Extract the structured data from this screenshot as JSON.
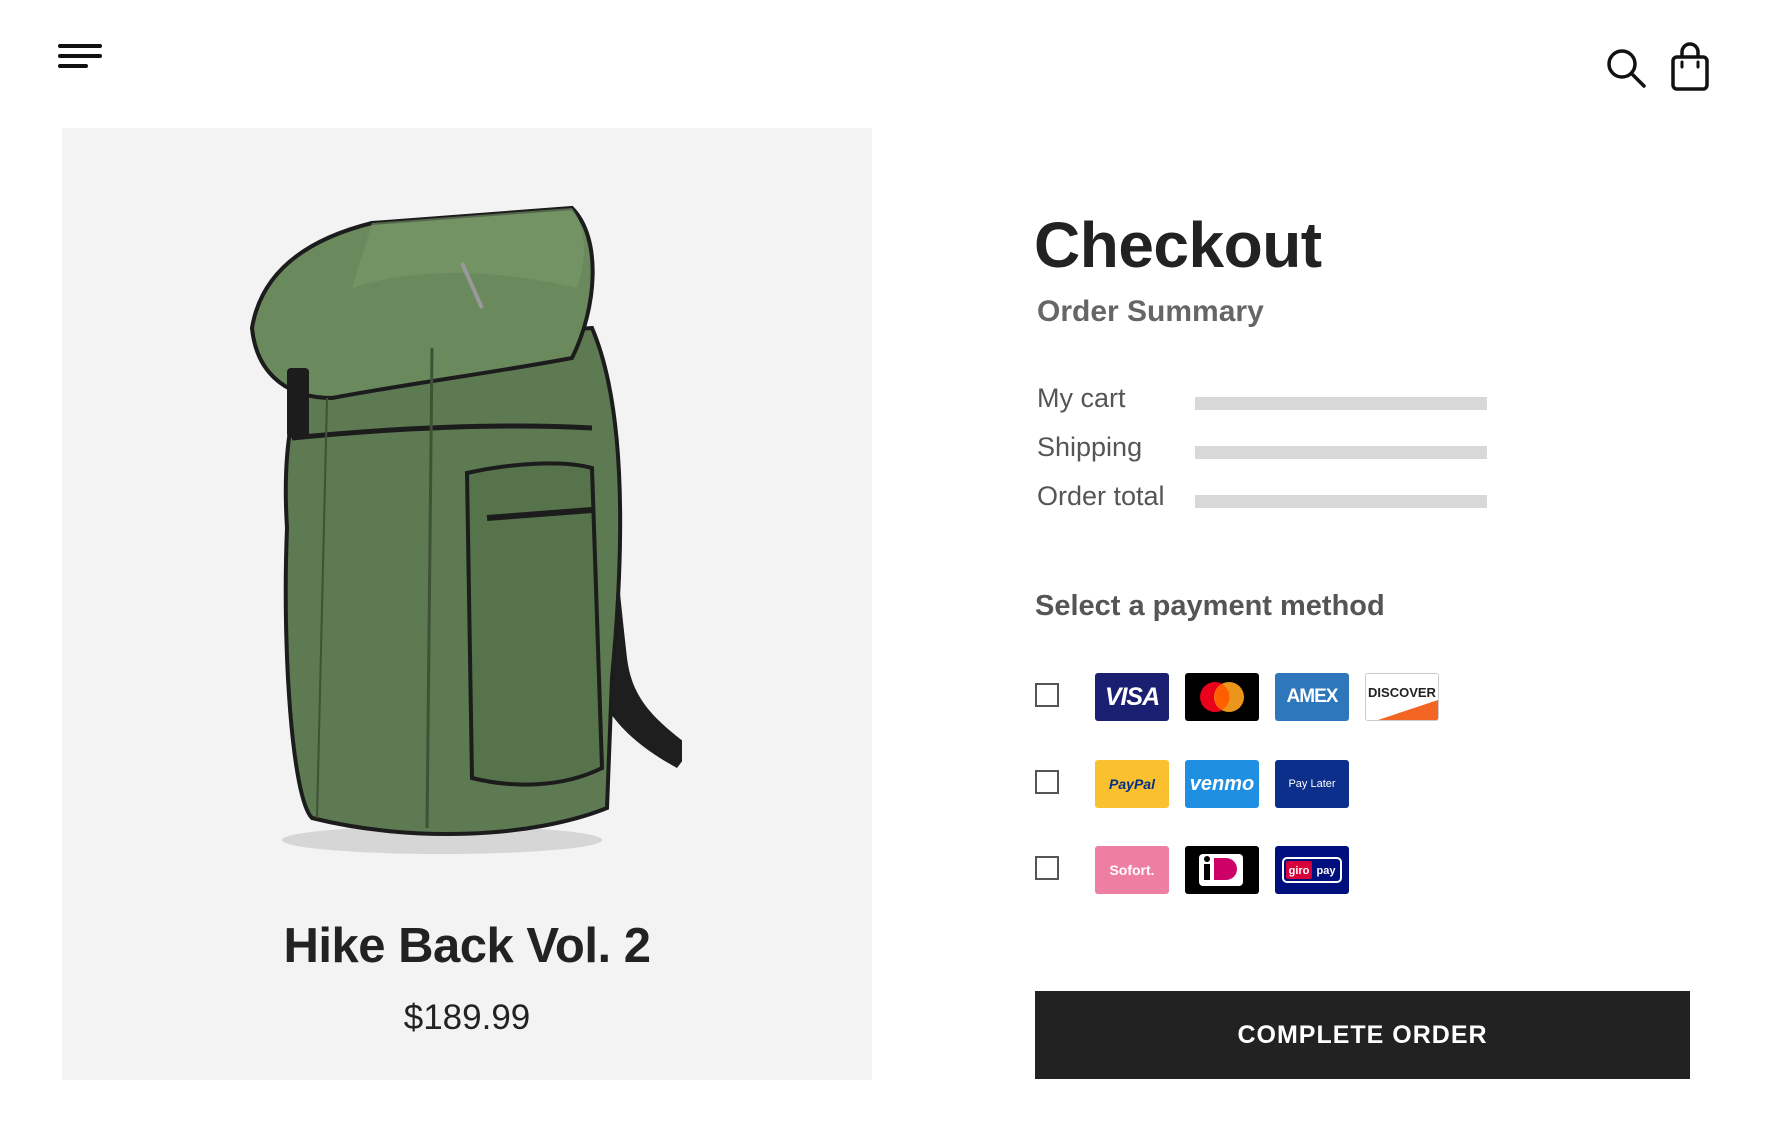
{
  "header": {
    "menu_icon": "hamburger-menu-icon",
    "search_icon": "search-icon",
    "cart_icon": "shopping-bag-icon"
  },
  "product": {
    "name": "Hike Back Vol. 2",
    "price": "$189.99",
    "image": "green-backpack-image",
    "colors": {
      "panel_bg": "#f3f3f3",
      "backpack": "#5d7a52"
    }
  },
  "checkout": {
    "title": "Checkout",
    "summary_title": "Order Summary",
    "summary_rows": [
      {
        "label": "My cart"
      },
      {
        "label": "Shipping"
      },
      {
        "label": "Order total"
      }
    ],
    "payment_title": "Select a payment method",
    "payment_rows": [
      {
        "checked": false,
        "methods": [
          "VISA",
          "Mastercard",
          "AMEX",
          "DISCOVER"
        ]
      },
      {
        "checked": false,
        "methods": [
          "PayPal",
          "venmo",
          "Pay Later"
        ]
      },
      {
        "checked": false,
        "methods": [
          "Sofort.",
          "iDEAL",
          "giropay"
        ]
      }
    ],
    "logo_text": {
      "visa": "VISA",
      "amex": "AMEX",
      "discover": "DISCOVER",
      "paypal": "PayPal",
      "venmo": "venmo",
      "paylater": "Pay Later",
      "sofort": "Sofort.",
      "ideal": "iDEAL",
      "giro": "giro",
      "pay": "pay"
    },
    "complete_label": "COMPLETE ORDER"
  },
  "colors": {
    "button_bg": "#222222",
    "summary_bar": "#d8d8d8",
    "text_dark": "#222222",
    "text_muted": "#666666"
  }
}
